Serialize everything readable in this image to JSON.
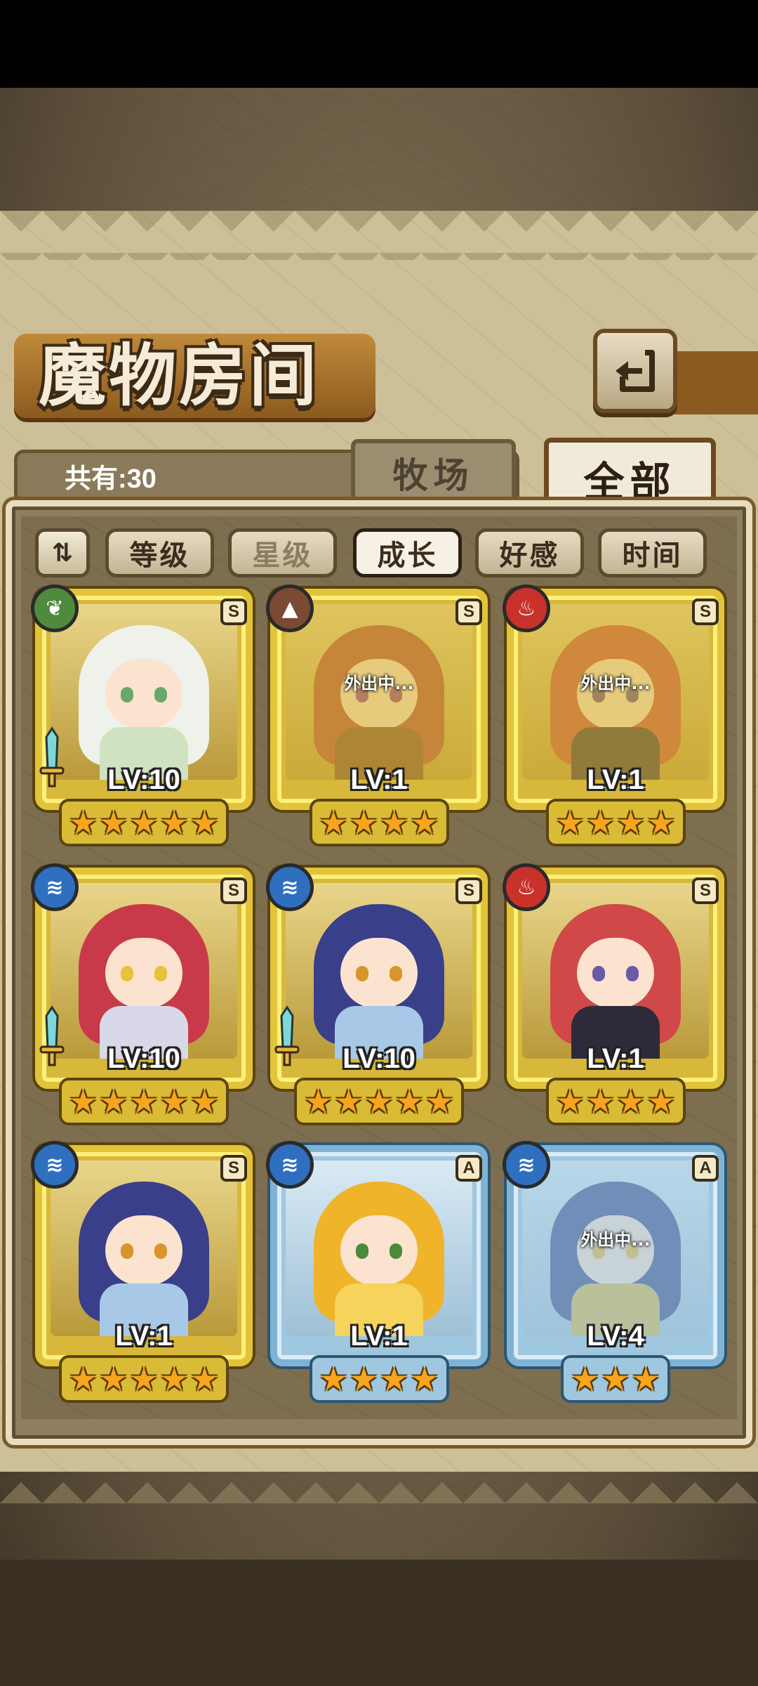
{
  "header": {
    "title": "魔物房间"
  },
  "tabs": [
    {
      "label": "牧场",
      "active": false
    },
    {
      "label": "全部",
      "active": true
    }
  ],
  "count_label": "共有:30",
  "sort": {
    "buttons": [
      {
        "label": "等级",
        "state": "normal"
      },
      {
        "label": "星级",
        "state": "dim"
      },
      {
        "label": "成长",
        "state": "active"
      },
      {
        "label": "好感",
        "state": "normal"
      },
      {
        "label": "时间",
        "state": "normal"
      }
    ]
  },
  "monsters": [
    {
      "element": "grass",
      "element_icon": "leaf-icon",
      "rank": "S",
      "level": "LV:10",
      "stars": 5,
      "away": false,
      "weapon": true,
      "hair": "#eef2ea",
      "outfit": "#cfe3c2",
      "eyes": "#6aa86a",
      "elem_color": "#4f8a3d"
    },
    {
      "element": "earth",
      "element_icon": "mountain-icon",
      "rank": "S",
      "level": "LV:1",
      "stars": 4,
      "away": true,
      "away_label": "外出中...",
      "weapon": false,
      "hair": "#b14a3a",
      "outfit": "#7a4b2f",
      "eyes": "#8b3a8a",
      "elem_color": "#7a4a32"
    },
    {
      "element": "fire",
      "element_icon": "flame-icon",
      "rank": "S",
      "level": "LV:1",
      "stars": 4,
      "away": true,
      "away_label": "外出中...",
      "weapon": false,
      "hair": "#c8503f",
      "outfit": "#3a3040",
      "eyes": "#5b4a8a",
      "elem_color": "#c8322a"
    },
    {
      "element": "water",
      "element_icon": "water-icon",
      "rank": "S",
      "level": "LV:10",
      "stars": 5,
      "away": false,
      "weapon": true,
      "hair": "#c83a4a",
      "outfit": "#d8d8e8",
      "eyes": "#e8c23a",
      "elem_color": "#2f6fc0"
    },
    {
      "element": "water",
      "element_icon": "water-icon",
      "rank": "S",
      "level": "LV:10",
      "stars": 5,
      "away": false,
      "weapon": true,
      "hair": "#3a3f8a",
      "outfit": "#a8c8e8",
      "eyes": "#d8962a",
      "elem_color": "#2f6fc0"
    },
    {
      "element": "fire",
      "element_icon": "flame-icon",
      "rank": "S",
      "level": "LV:1",
      "stars": 4,
      "away": false,
      "weapon": false,
      "hair": "#d04848",
      "outfit": "#2e2a3a",
      "eyes": "#6a5aa8",
      "elem_color": "#c8322a"
    },
    {
      "element": "water",
      "element_icon": "water-icon",
      "rank": "S",
      "level": "LV:1",
      "stars": 5,
      "away": false,
      "weapon": false,
      "hair": "#3a3f8a",
      "outfit": "#a8c8e8",
      "eyes": "#d8962a",
      "elem_color": "#2f6fc0"
    },
    {
      "element": "water",
      "element_icon": "water-icon",
      "rank": "A",
      "level": "LV:1",
      "stars": 4,
      "away": false,
      "weapon": false,
      "hair": "#f0b42a",
      "outfit": "#f6d35a",
      "eyes": "#4a8a3a",
      "elem_color": "#2f6fc0"
    },
    {
      "element": "water",
      "element_icon": "water-icon",
      "rank": "A",
      "level": "LV:4",
      "stars": 3,
      "away": true,
      "away_label": "外出中...",
      "weapon": false,
      "hair": "#3a4a8a",
      "outfit": "#d8b84a",
      "eyes": "#e8b83a",
      "elem_color": "#2f6fc0"
    }
  ]
}
